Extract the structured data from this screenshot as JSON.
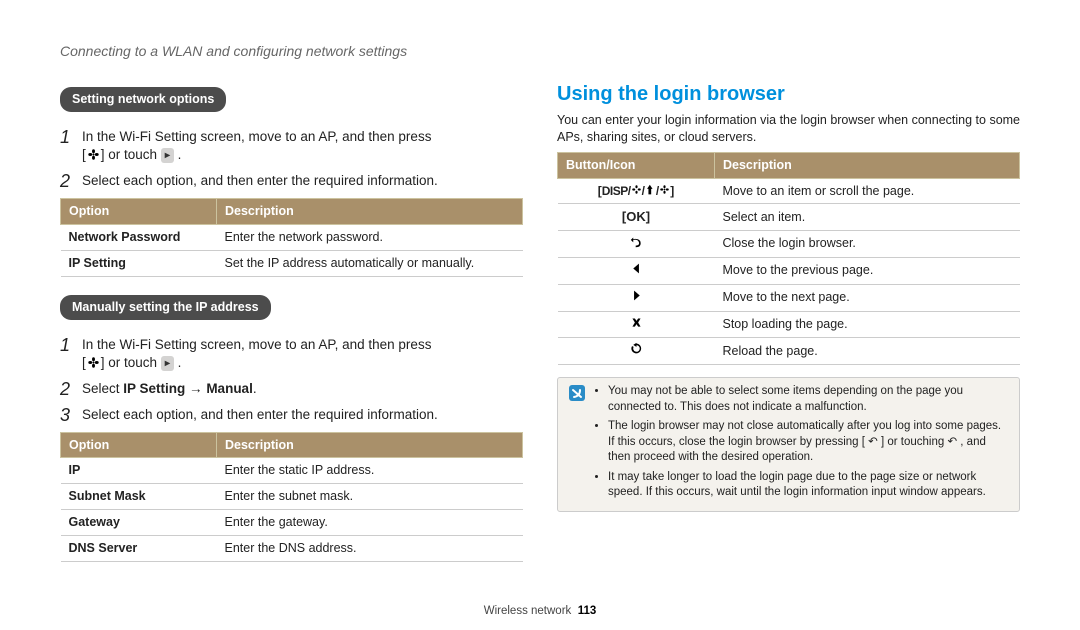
{
  "page_header": "Connecting to a WLAN and configuring network settings",
  "left": {
    "section1": {
      "pill": "Setting network options",
      "step1_a": "In the Wi-Fi Setting screen, move to an AP, and then press",
      "step1_b": "or touch",
      "step2": "Select each option, and then enter the required information.",
      "table": {
        "h1": "Option",
        "h2": "Description",
        "rows": [
          {
            "o": "Network Password",
            "d": "Enter the network password."
          },
          {
            "o": "IP Setting",
            "d": "Set the IP address automatically or manually."
          }
        ]
      }
    },
    "section2": {
      "pill": "Manually setting the IP address",
      "step1_a": "In the Wi-Fi Setting screen, move to an AP, and then press",
      "step1_b": "or touch",
      "step2_pre": "Select ",
      "step2_bold1": "IP Setting",
      "step2_arrow": " → ",
      "step2_bold2": "Manual",
      "step2_post": ".",
      "step3": "Select each option, and then enter the required information.",
      "table": {
        "h1": "Option",
        "h2": "Description",
        "rows": [
          {
            "o": "IP",
            "d": "Enter the static IP address."
          },
          {
            "o": "Subnet Mask",
            "d": "Enter the subnet mask."
          },
          {
            "o": "Gateway",
            "d": "Enter the gateway."
          },
          {
            "o": "DNS Server",
            "d": "Enter the DNS address."
          }
        ]
      }
    }
  },
  "right": {
    "heading": "Using the login browser",
    "intro": "You can enter your login information via the login browser when connecting to some APs, sharing sites, or cloud servers.",
    "table": {
      "h1": "Button/Icon",
      "h2": "Description",
      "rows": [
        {
          "icon": "dpad",
          "d": "Move to an item or scroll the page."
        },
        {
          "icon": "ok",
          "d": "Select an item."
        },
        {
          "icon": "back",
          "d": "Close the login browser."
        },
        {
          "icon": "left",
          "d": "Move to the previous page."
        },
        {
          "icon": "right",
          "d": "Move to the next page."
        },
        {
          "icon": "stop",
          "d": "Stop loading the page."
        },
        {
          "icon": "reload",
          "d": "Reload the page."
        }
      ]
    },
    "note": {
      "items": [
        "You may not be able to select some items depending on the page you connected to. This does not indicate a malfunction.",
        "The login browser may not close automatically after you log into some pages. If this occurs, close the login browser by pressing [ ↶ ] or touching ↶ , and then proceed with the desired operation.",
        "It may take longer to load the login page due to the page size or network speed. If this occurs, wait until the login information input window appears."
      ]
    }
  },
  "footer": {
    "section": "Wireless network",
    "page": "113"
  }
}
